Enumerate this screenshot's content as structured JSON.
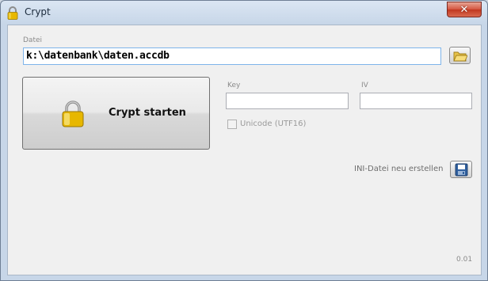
{
  "window": {
    "title": "Crypt",
    "close_symbol": "✕",
    "icons": {
      "title": "lock-icon",
      "close": "close-icon"
    }
  },
  "file": {
    "label": "Datei",
    "value": "k:\\datenbank\\daten.accdb",
    "browse_icon": "folder-icon"
  },
  "action": {
    "label": "Crypt starten",
    "icon": "lock-icon"
  },
  "key": {
    "label": "Key",
    "value": ""
  },
  "iv": {
    "label": "IV",
    "value": ""
  },
  "unicode": {
    "label": "Unicode (UTF16)",
    "checked": false,
    "enabled": false
  },
  "ini": {
    "label": "INI-Datei neu erstellen",
    "icon": "save-icon"
  },
  "version": "0.01"
}
